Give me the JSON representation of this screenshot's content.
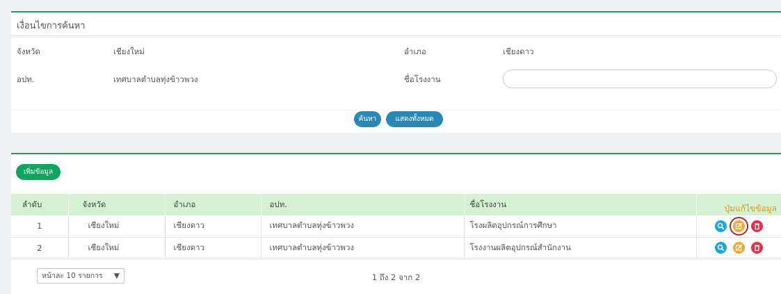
{
  "search_panel": {
    "title": "เงื่อนไขการค้นหา",
    "province_label": "จังหวัด",
    "province_value": "เชียงใหม่",
    "district_label": "อำเภอ",
    "district_value": "เชียงดาว",
    "lao_label": "อปท.",
    "lao_value": "เทศบาลตำบลทุ่งข้าวพวง",
    "factory_label": "ชื่อโรงงาน",
    "factory_value": "",
    "search_button": "ค้นหา",
    "show_all_button": "แสดงทั้งหมด"
  },
  "results_panel": {
    "add_button": "เพิ่มข้อมูล",
    "edit_hint": "ปุ่มแก้ไขข้อมูล",
    "columns": [
      "ลำดับ",
      "จังหวัด",
      "อำเภอ",
      "อปท.",
      "ชื่อโรงงาน"
    ],
    "rows": [
      {
        "no": "1",
        "province": "เชียงใหม่",
        "district": "เชียงดาว",
        "lao": "เทศบาลตำบลทุ่งข้าวพวง",
        "factory": "โรงผลิตอุปกรณ์การศึกษา"
      },
      {
        "no": "2",
        "province": "เชียงใหม่",
        "district": "เชียงดาว",
        "lao": "เทศบาลตำบลทุ่งข้าวพวง",
        "factory": "โรงงานผลิตอุปกรณ์สำนักงาน"
      }
    ],
    "page_size": "หน้าละ 10 รายการ",
    "page_info": "1 ถึง 2 จาก 2"
  },
  "colors": {
    "primary": "#2a88b6",
    "success": "#10a55c",
    "header_bg": "#d4f1d3",
    "view_icon": "#17a9d8",
    "edit_icon": "#f0a93b",
    "delete_icon": "#e0334a",
    "hint_text": "#d99a1e"
  },
  "icons": [
    "search-icon",
    "edit-icon",
    "delete-icon",
    "caret-down-icon"
  ]
}
